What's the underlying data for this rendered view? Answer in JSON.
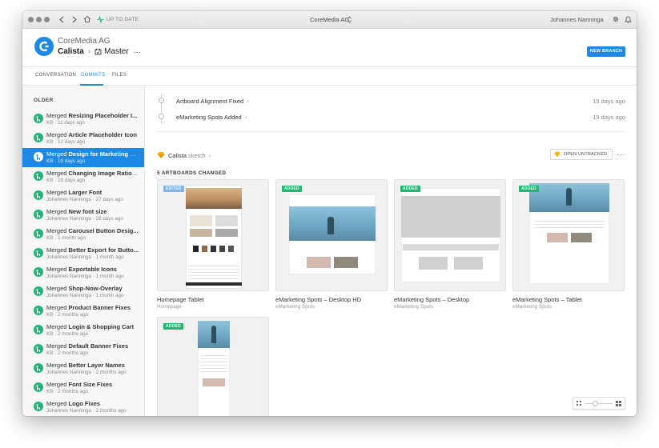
{
  "titlebar": {
    "status": "UP TO DATE",
    "title": "CoreMedia AG",
    "user": "Johannes Nanninga"
  },
  "header": {
    "org": "CoreMedia AG",
    "project": "Calista",
    "branch": "Master",
    "new_branch_label": "NEW BRANCH"
  },
  "tabs": [
    "CONVERSATION",
    "COMMITS",
    "FILES"
  ],
  "sidebar": {
    "heading": "OLDER",
    "commits": [
      {
        "prefix": "Merged ",
        "title": "Resizing Placeholder I...",
        "meta": "KB · 11 days ago"
      },
      {
        "prefix": "Merged ",
        "title": "Article Placeholder Icon",
        "meta": "KB · 12 days ago"
      },
      {
        "prefix": "Merged ",
        "title": "Design for Marketing S...",
        "meta": "KB · 19 days ago"
      },
      {
        "prefix": "Merged ",
        "title": "Changing Image Ratio ...",
        "meta": "KB · 19 days ago"
      },
      {
        "prefix": "Merged ",
        "title": "Larger Font",
        "meta": "Johannes Nanninga · 27 days ago"
      },
      {
        "prefix": "Merged ",
        "title": "New font size",
        "meta": "Johannes Nanninga · 28 days ago"
      },
      {
        "prefix": "Merged ",
        "title": "Carousel Button Desig...",
        "meta": "KB · 1 month ago"
      },
      {
        "prefix": "Merged ",
        "title": "Better Export for Butto...",
        "meta": "Johannes Nanninga · 1 month ago"
      },
      {
        "prefix": "Merged ",
        "title": "Exportable Icons",
        "meta": "Johannes Nanninga · 1 month ago"
      },
      {
        "prefix": "Merged ",
        "title": "Shop-Now-Overlay",
        "meta": "Johannes Nanninga · 1 month ago"
      },
      {
        "prefix": "Merged ",
        "title": "Product Banner Fixes",
        "meta": "KB · 2 months ago"
      },
      {
        "prefix": "Merged ",
        "title": "Login & Shopping Cart",
        "meta": "KB · 2 months ago"
      },
      {
        "prefix": "Merged ",
        "title": "Default Banner Fixes",
        "meta": "KB · 2 months ago"
      },
      {
        "prefix": "Merged ",
        "title": "Better Layer Names",
        "meta": "Johannes Nanninga · 2 months ago"
      },
      {
        "prefix": "Merged ",
        "title": "Font Size Fixes",
        "meta": "KB · 2 months ago"
      },
      {
        "prefix": "Merged ",
        "title": "Logo Fixes",
        "meta": "Johannes Nanninga · 2 months ago"
      }
    ]
  },
  "timeline": [
    {
      "label": "Artboard Alignment Fixed",
      "time": "19 days ago"
    },
    {
      "label": "eMarketing Spots Added",
      "time": "19 days ago"
    }
  ],
  "file": {
    "name": "Calista",
    "ext": ".sketch",
    "open_label": "OPEN UNTRACKED",
    "more": "···"
  },
  "artboards_heading": "5 ARTBOARDS CHANGED",
  "artboards": [
    {
      "badge": "EDITED",
      "title": "Homepage Tablet",
      "page": "Homepage"
    },
    {
      "badge": "ADDED",
      "title": "eMarketing Spots – Desktop HD",
      "page": "eMarketing Spots"
    },
    {
      "badge": "ADDED",
      "title": "eMarketing Spots – Desktop",
      "page": "eMarketing Spots"
    },
    {
      "badge": "ADDED",
      "title": "eMarketing Spots – Tablet",
      "page": "eMarketing Spots"
    },
    {
      "badge": "ADDED",
      "title": "",
      "page": ""
    }
  ]
}
